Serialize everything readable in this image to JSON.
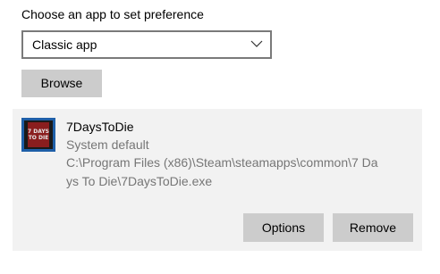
{
  "section": {
    "label": "Choose an app to set preference"
  },
  "dropdown": {
    "selected": "Classic app"
  },
  "buttons": {
    "browse": "Browse",
    "options": "Options",
    "remove": "Remove"
  },
  "app": {
    "name": "7DaysToDie",
    "status": "System default",
    "path": "C:\\Program Files (x86)\\Steam\\steamapps\\common\\7 Days To Die\\7DaysToDie.exe",
    "icon_text": "7 DAYS TO DIE"
  },
  "colors": {
    "button_bg": "#cccccc",
    "panel_bg": "#f2f2f2",
    "secondary_text": "#767676",
    "icon_border": "#1f5fa8"
  },
  "icons": {
    "dropdown": "chevron-down-icon",
    "app": "app-icon"
  }
}
